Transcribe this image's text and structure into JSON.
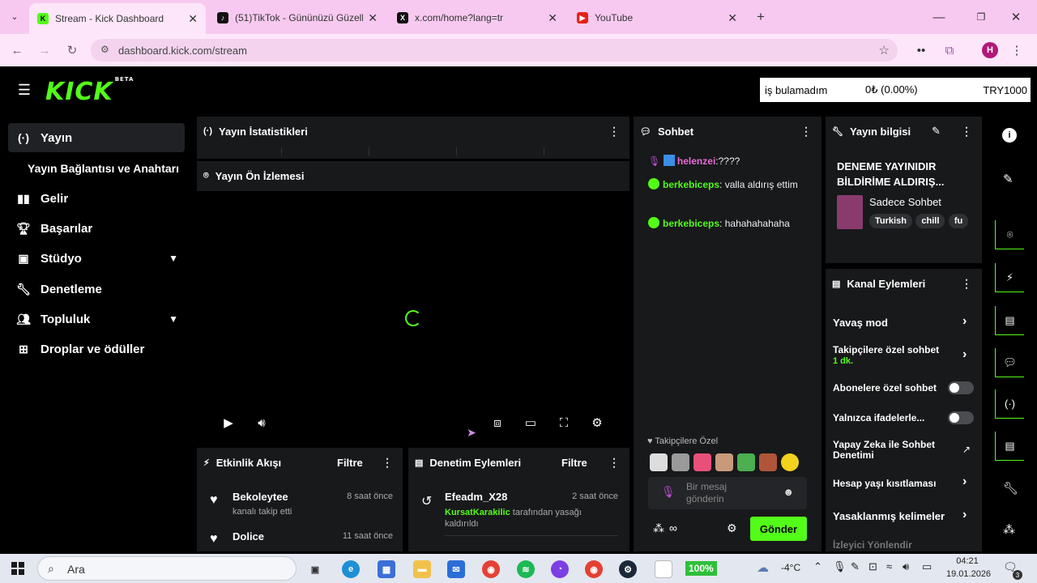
{
  "browser": {
    "tabs": [
      {
        "title": "Stream - Kick Dashboard",
        "icon": "kick-icon"
      },
      {
        "title": "(51)TikTok - Gününüzü Güzelleş",
        "icon": "tiktok-icon"
      },
      {
        "title": "x.com/home?lang=tr",
        "icon": "x-icon"
      },
      {
        "title": "YouTube",
        "icon": "youtube-icon"
      }
    ],
    "url": "dashboard.kick.com/stream",
    "profile_initial": "H"
  },
  "header": {
    "logo": "KICK",
    "logo_badge": "BETA",
    "ticker": {
      "name": "iş bulamadım",
      "change": "0₺ (0.00%)",
      "goal": "TRY1000"
    }
  },
  "sidebar": {
    "items": [
      {
        "label": "Yayın",
        "icon": "broadcast-icon"
      },
      {
        "label": "Yayın Bağlantısı ve Anahtarı"
      },
      {
        "label": "Gelir",
        "icon": "revenue-icon"
      },
      {
        "label": "Başarılar",
        "icon": "trophy-icon"
      },
      {
        "label": "Stüdyo",
        "icon": "studio-icon"
      },
      {
        "label": "Denetleme",
        "icon": "wrench-icon"
      },
      {
        "label": "Topluluk",
        "icon": "community-icon"
      },
      {
        "label": "Droplar ve ödüller",
        "icon": "drops-icon"
      }
    ]
  },
  "stats": {
    "title": "Yayın İstatistikleri"
  },
  "preview": {
    "title": "Yayın Ön İzlemesi"
  },
  "activity": {
    "title": "Etkinlik Akışı",
    "filter": "Filtre",
    "items": [
      {
        "user": "Bekoleytee",
        "time": "8 saat önce",
        "text": "kanalı takip etti"
      },
      {
        "user": "Dolice",
        "time": "11 saat önce"
      }
    ]
  },
  "moderation": {
    "title": "Denetim Eylemleri",
    "filter": "Filtre",
    "items": [
      {
        "user": "Efeadm_X28",
        "time": "2 saat önce",
        "actor": "KursatKarakilic",
        "text": "tarafından yasağı kaldırıldı"
      }
    ]
  },
  "chat": {
    "title": "Sohbet",
    "messages": [
      {
        "user": "helenzei",
        "text": ":????"
      },
      {
        "user": "berkebiceps",
        "text": ": valla aldırış ettim"
      },
      {
        "user": "berkebiceps",
        "text": ": hahahahahaha"
      }
    ],
    "followers_only": "Takipçilere Özel",
    "placeholder": "Bir mesaj gönderin",
    "send": "Gönder"
  },
  "stream_info": {
    "title": "Yayın bilgisi",
    "stream_title": "DENEME YAYINIDIR BİLDİRİME ALDIRIŞ...",
    "category": "Sadece Sohbet",
    "tags": [
      "Turkish",
      "chill",
      "fu"
    ]
  },
  "channel_actions": {
    "title": "Kanal Eylemleri",
    "items": [
      {
        "label": "Yavaş mod"
      },
      {
        "label": "Takipçilere özel sohbet",
        "sub": "1 dk."
      },
      {
        "label": "Abonelere özel sohbet"
      },
      {
        "label": "Yalnızca ifadelerle..."
      },
      {
        "label": "Yapay Zeka ile Sohbet Denetimi"
      },
      {
        "label": "Hesap yaşı kısıtlaması"
      },
      {
        "label": "Yasaklanmış kelimeler"
      },
      {
        "label": "İzleyici Yönlendir"
      }
    ]
  },
  "taskbar": {
    "search": "Ara",
    "battery": "100%",
    "temp": "-4°C",
    "time": "04:21",
    "date": "19.01.2026",
    "notif": "3"
  }
}
